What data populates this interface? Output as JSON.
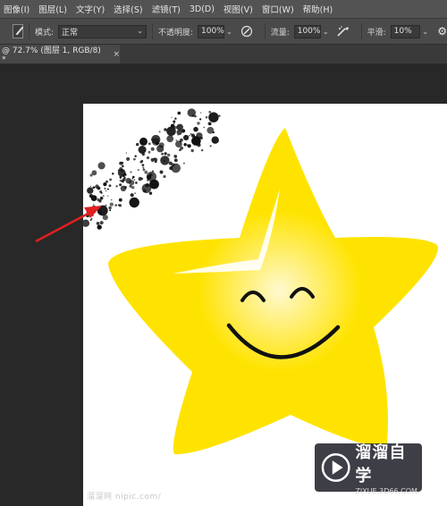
{
  "menu": [
    "图像(I)",
    "图层(L)",
    "文字(Y)",
    "选择(S)",
    "滤镜(T)",
    "3D(D)",
    "视图(V)",
    "窗口(W)",
    "帮助(H)"
  ],
  "options": {
    "mode_label": "模式:",
    "mode_value": "正常",
    "opacity_label": "不透明度:",
    "opacity_value": "100%",
    "flow_label": "流量:",
    "flow_value": "100%",
    "smoothing_label": "平滑:",
    "smoothing_value": "10%"
  },
  "tab": {
    "title": "@ 72.7% (图层 1, RGB/8) *",
    "close": "×"
  },
  "canvas": {
    "star_color": "#FFE300",
    "star_center_color": "#FFF9D0",
    "spatter_color": "#111111",
    "arrow_color": "#E02020"
  },
  "watermark": {
    "bottom_text": "溜溜网 nipic.com/",
    "brand_name": "溜溜自学",
    "brand_url": "ZIXUE.3D66.COM"
  }
}
